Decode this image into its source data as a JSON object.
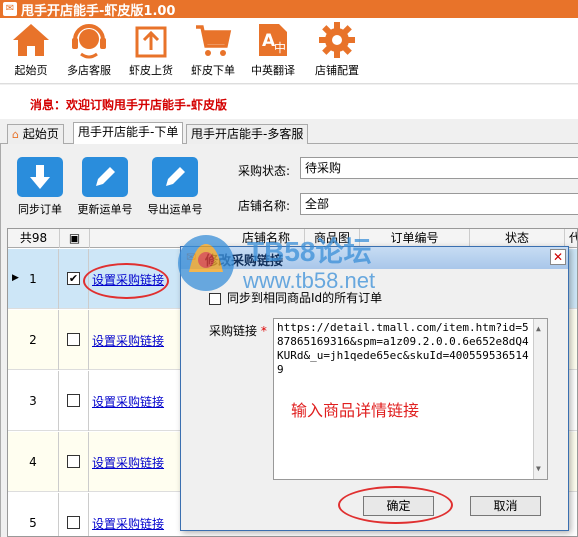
{
  "window": {
    "title": "甩手开店能手-虾皮版1.00",
    "app_icon_text": "✉"
  },
  "toolbar": {
    "items": [
      {
        "label": "起始页",
        "icon": "home-icon"
      },
      {
        "label": "多店客服",
        "icon": "headset-icon"
      },
      {
        "label": "虾皮上货",
        "icon": "upload-box-icon"
      },
      {
        "label": "虾皮下单",
        "icon": "cart-icon"
      },
      {
        "label": "中英翻译",
        "icon": "translate-icon"
      },
      {
        "label": "店铺配置",
        "icon": "gear-icon"
      }
    ]
  },
  "message": {
    "text": "消息：欢迎订购甩手开店能手-虾皮版"
  },
  "tabs": [
    {
      "label": "起始页",
      "active": false
    },
    {
      "label": "甩手开店能手-下单",
      "active": true
    },
    {
      "label": "甩手开店能手-多客服",
      "active": false
    }
  ],
  "actions": [
    {
      "label": "同步订单",
      "icon": "download-icon"
    },
    {
      "label": "更新运单号",
      "icon": "pencil-icon"
    },
    {
      "label": "导出运单号",
      "icon": "pencil-icon"
    }
  ],
  "filters": {
    "status_label": "采购状态:",
    "status_value": "待采购",
    "shop_label": "店铺名称:",
    "shop_value": "全部"
  },
  "grid": {
    "headers": [
      "共98",
      "▣",
      "店铺名称",
      "商品图",
      "订单编号",
      "状态",
      "代"
    ],
    "rows": [
      {
        "num": "1",
        "checked": true,
        "link": "设置采购链接",
        "selected": true
      },
      {
        "num": "2",
        "checked": false,
        "link": "设置采购链接",
        "selected": false
      },
      {
        "num": "3",
        "checked": false,
        "link": "设置采购链接",
        "selected": false
      },
      {
        "num": "4",
        "checked": false,
        "link": "设置采购链接",
        "selected": false
      },
      {
        "num": "5",
        "checked": false,
        "link": "设置采购链接",
        "selected": false
      }
    ]
  },
  "dialog": {
    "title": "修改采购链接",
    "sync_checkbox_label": "同步到相同商品Id的所有订单",
    "field_label": "采购链接",
    "required_mark": "*",
    "url_value": "https://detail.tmall.com/item.htm?id=587865169316&spm=a1z09.2.0.0.6e652e8dQ4KURd&_u=jh1qede65ec&skuId=4005595365149",
    "hint": "输入商品详情链接",
    "ok_label": "确定",
    "cancel_label": "取消"
  },
  "watermark": {
    "line1": "TB58论坛",
    "line2": "www.tb58.net"
  },
  "colors": {
    "titlebar": "#e8732a",
    "toolbar_icon": "#e8732a",
    "action_blue": "#2a8ddc",
    "message_red": "#d40000",
    "highlight_ring": "#e03030"
  }
}
